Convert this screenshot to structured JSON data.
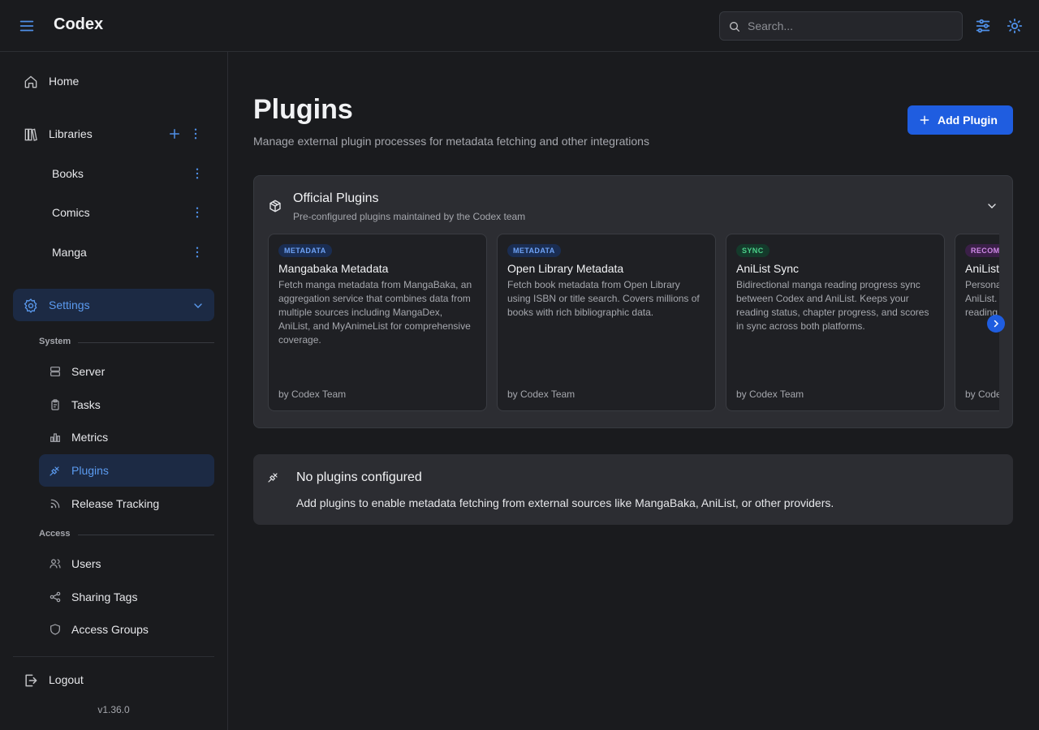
{
  "app": {
    "title": "Codex"
  },
  "header": {
    "menu_icon": "hamburger-icon",
    "search": {
      "placeholder": "Search...",
      "value": ""
    },
    "actions": [
      "sliders-icon",
      "sun-icon"
    ]
  },
  "sidebar": {
    "home": {
      "label": "Home",
      "icon": "home-icon"
    },
    "libraries": {
      "label": "Libraries",
      "icon": "library-icon",
      "items": [
        {
          "label": "Books"
        },
        {
          "label": "Comics"
        },
        {
          "label": "Manga"
        }
      ]
    },
    "settings": {
      "label": "Settings",
      "icon": "gear-icon",
      "expanded": true
    },
    "system": {
      "label": "System",
      "items": [
        {
          "label": "Server",
          "icon": "server-icon"
        },
        {
          "label": "Tasks",
          "icon": "clipboard-icon"
        },
        {
          "label": "Metrics",
          "icon": "bar-chart-icon"
        },
        {
          "label": "Plugins",
          "icon": "plug-icon",
          "active": true
        },
        {
          "label": "Release Tracking",
          "icon": "rss-icon"
        }
      ]
    },
    "access": {
      "label": "Access",
      "items": [
        {
          "label": "Users",
          "icon": "users-icon"
        },
        {
          "label": "Sharing Tags",
          "icon": "share-icon"
        },
        {
          "label": "Access Groups",
          "icon": "shield-icon"
        }
      ]
    },
    "logout": {
      "label": "Logout",
      "icon": "logout-icon"
    },
    "version": "v1.36.0"
  },
  "main": {
    "title": "Plugins",
    "subtitle": "Manage external plugin processes for metadata fetching and other integrations",
    "add_button": "Add Plugin",
    "official": {
      "title": "Official Plugins",
      "subtitle": "Pre-configured plugins maintained by the Codex team",
      "cards": [
        {
          "badge": "METADATA",
          "name": "Mangabaka Metadata",
          "description": "Fetch manga metadata from MangaBaka, an aggregation service that combines data from multiple sources including MangaDex, AniList, and MyAnimeList for comprehensive coverage.",
          "author": "by Codex Team"
        },
        {
          "badge": "METADATA",
          "name": "Open Library Metadata",
          "description": "Fetch book metadata from Open Library using ISBN or title search. Covers millions of books with rich bibliographic data.",
          "author": "by Codex Team"
        },
        {
          "badge": "SYNC",
          "name": "AniList Sync",
          "description": "Bidirectional manga reading progress sync between Codex and AniList. Keeps your reading status, chapter progress, and scores in sync across both platforms.",
          "author": "by Codex Team"
        },
        {
          "badge": "RECOMMENDATIONS",
          "name": "AniList Recommendations",
          "description": "Personalized recommendations powered by AniList. Generates suggestions from your reading history.",
          "author": "by Codex Team"
        }
      ]
    },
    "empty": {
      "title": "No plugins configured",
      "description": "Add plugins to enable metadata fetching from external sources like MangaBaka, AniList, or other providers."
    }
  },
  "colors": {
    "accent": "#1f5de0",
    "link": "#5b9bf0",
    "bg": "#1a1b1e",
    "panel": "#2c2d32"
  }
}
